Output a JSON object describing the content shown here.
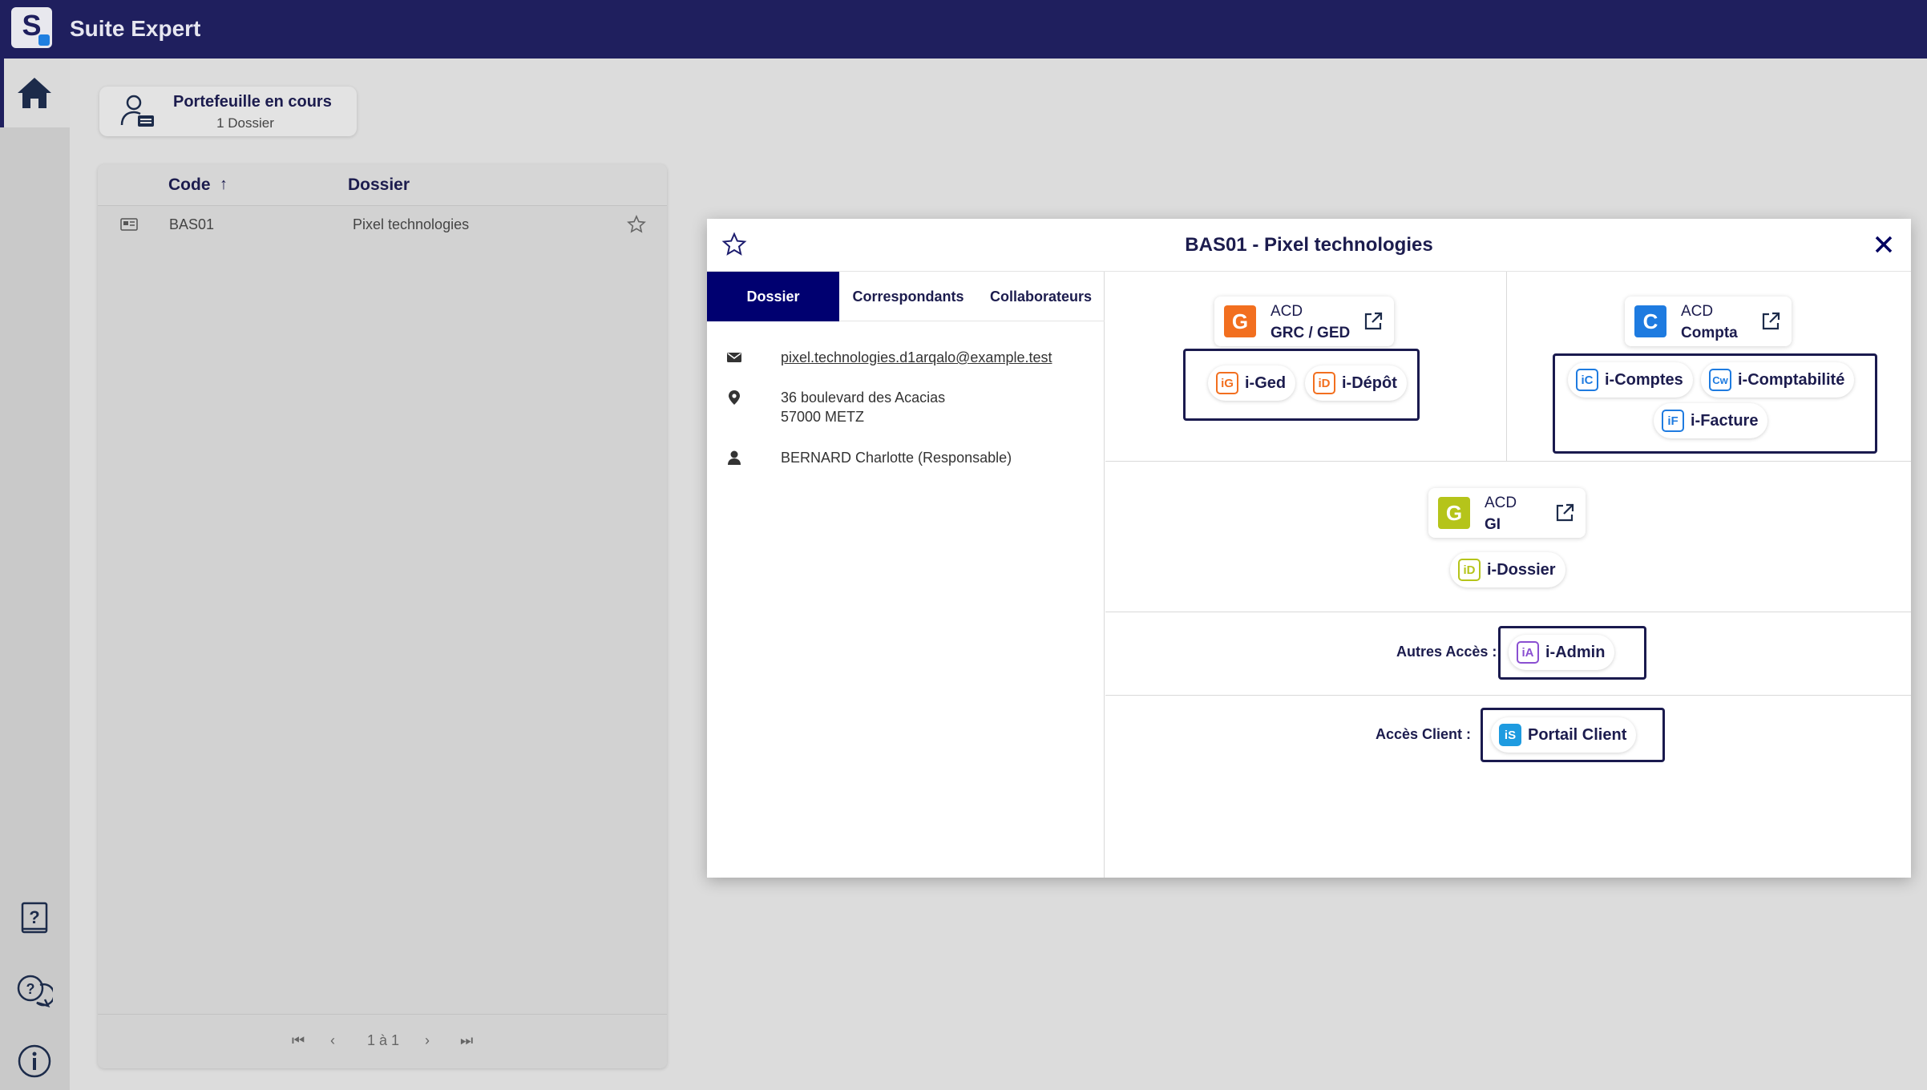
{
  "header": {
    "app_title": "Suite Expert",
    "logo_letter": "S"
  },
  "sidebar": {
    "home": "home-icon",
    "bottom_icons": [
      "help-book-icon",
      "chat-help-icon",
      "info-icon"
    ]
  },
  "portfolio": {
    "title": "Portefeuille en cours",
    "subtitle": "1 Dossier"
  },
  "table": {
    "columns": [
      "Code",
      "Dossier"
    ],
    "sort_indicator": "↑",
    "rows": [
      {
        "code": "BAS01",
        "dossier": "Pixel technologies"
      }
    ],
    "pager": {
      "range": "1 à 1"
    }
  },
  "modal": {
    "title": "BAS01 - Pixel technologies",
    "tabs": [
      "Dossier",
      "Correspondants",
      "Collaborateurs"
    ],
    "active_tab": "Dossier",
    "info": {
      "email": "pixel.technologies.d1arqalo@example.test",
      "address_line1": "36 boulevard des Acacias",
      "address_line2": "57000 METZ",
      "responsible": "BERNARD Charlotte (Responsable)"
    },
    "apps": {
      "grc": {
        "l1": "ACD",
        "l2": "GRC / GED",
        "logo": "G",
        "color": "#f26f1f"
      },
      "compta": {
        "l1": "ACD",
        "l2": "Compta",
        "logo": "C",
        "color": "#1e7be0"
      },
      "gi": {
        "l1": "ACD",
        "l2": "GI",
        "logo": "G",
        "color": "#b5c41a"
      }
    },
    "chips": {
      "iged": {
        "icon": "iG",
        "label": "i-Ged",
        "color": "#f26f1f"
      },
      "idepot": {
        "icon": "iD",
        "label": "i-Dépôt",
        "color": "#f26f1f"
      },
      "icomptes": {
        "icon": "iC",
        "label": "i-Comptes",
        "color": "#1e7be0"
      },
      "icomptabilite": {
        "icon": "Cw",
        "label": "i-Comptabilité",
        "color": "#1e7be0"
      },
      "ifacture": {
        "icon": "iF",
        "label": "i-Facture",
        "color": "#1e7be0"
      },
      "idossier": {
        "icon": "iD",
        "label": "i-Dossier",
        "color": "#b5c41a"
      },
      "iadmin": {
        "icon": "iA",
        "label": "i-Admin",
        "color": "#8a4fd1"
      },
      "portail": {
        "icon": "iS",
        "label": "Portail Client",
        "color": "#1e9be0"
      }
    },
    "labels": {
      "autres_acces": "Autres Accès :",
      "acces_client": "Accès Client :"
    }
  }
}
